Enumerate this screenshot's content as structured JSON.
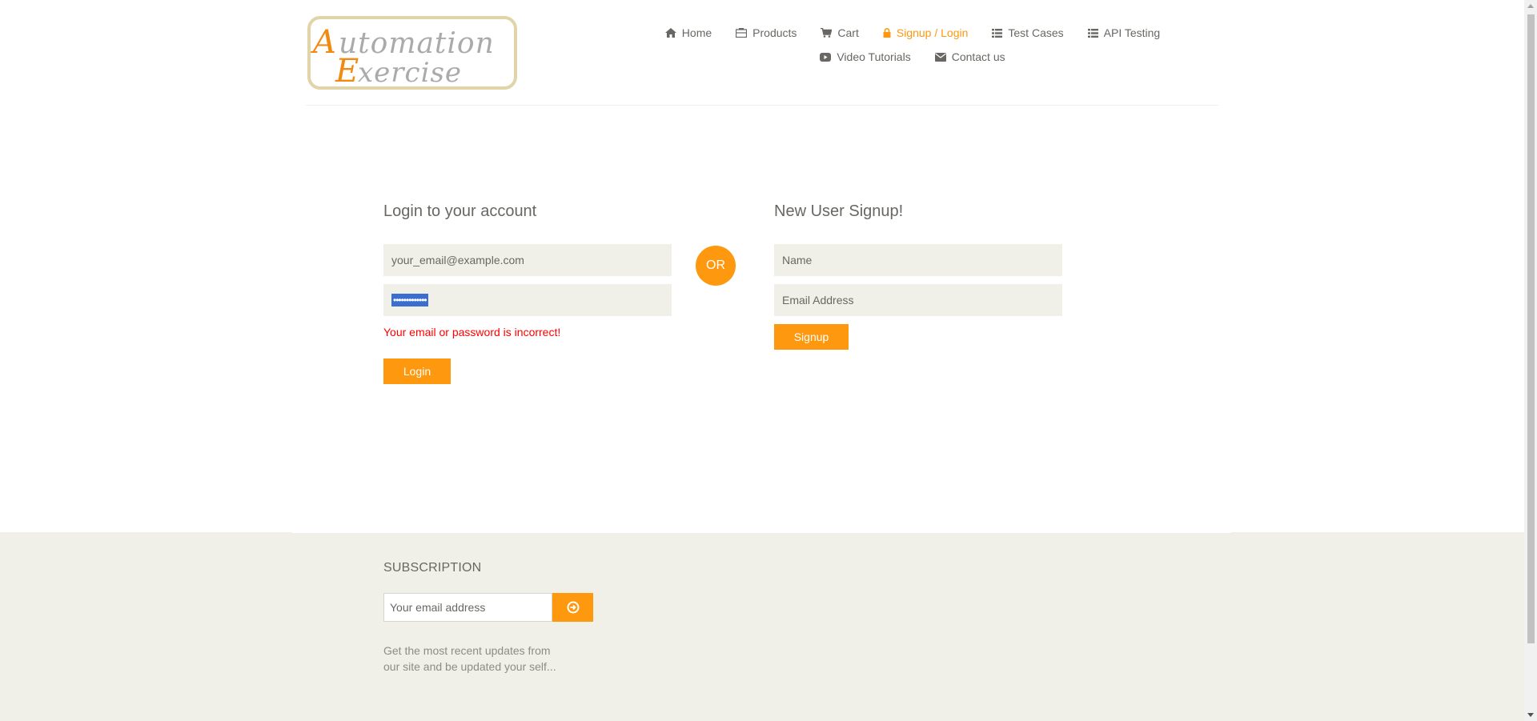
{
  "header": {
    "logo": {
      "word1": "utomation",
      "word1_initial": "A",
      "word2": "xercise",
      "word2_initial": "E"
    },
    "nav": [
      {
        "label": "Home",
        "icon": "home-icon"
      },
      {
        "label": "Products",
        "icon": "briefcase-icon"
      },
      {
        "label": "Cart",
        "icon": "cart-icon"
      },
      {
        "label": "Signup / Login",
        "icon": "lock-icon",
        "active": true
      },
      {
        "label": "Test Cases",
        "icon": "list-icon"
      },
      {
        "label": "API Testing",
        "icon": "list-icon"
      },
      {
        "label": "Video Tutorials",
        "icon": "youtube-play-icon"
      },
      {
        "label": "Contact us",
        "icon": "envelope-icon"
      }
    ]
  },
  "login": {
    "title": "Login to your account",
    "email_value": "your_email@example.com",
    "password_mask": "•••••••••••••",
    "error": "Your email or password is incorrect!",
    "button": "Login"
  },
  "or_label": "OR",
  "signup": {
    "title": "New User Signup!",
    "name_placeholder": "Name",
    "email_placeholder": "Email Address",
    "button": "Signup"
  },
  "footer": {
    "subscription_title": "SUBSCRIPTION",
    "email_placeholder": "Your email address",
    "description": "Get the most recent updates from our site and be updated your self..."
  },
  "colors": {
    "accent": "#fe980f",
    "text": "#696763",
    "field_bg": "#f0f0e9",
    "error": "#ff0000"
  }
}
